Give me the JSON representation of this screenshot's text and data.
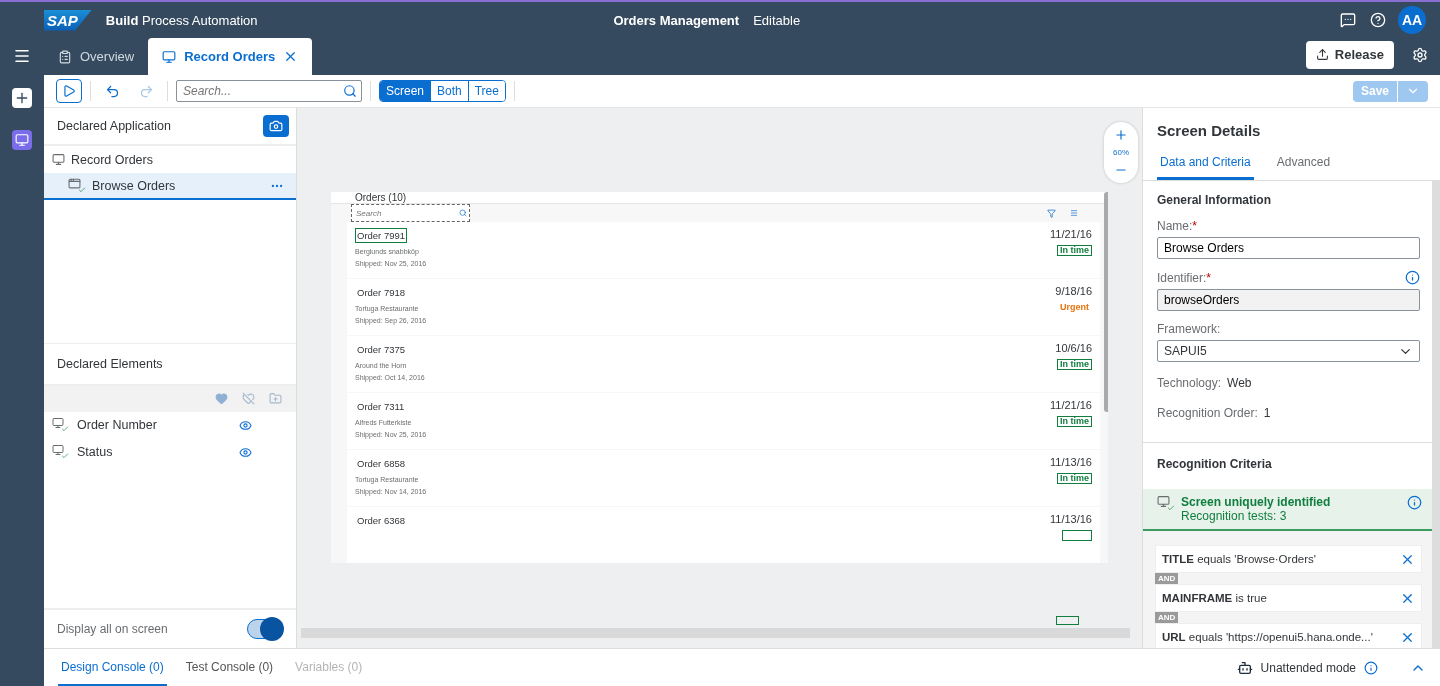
{
  "header": {
    "logo": "SAP",
    "product": "**Build** Process Automation",
    "title": "Orders Management",
    "mode": "Editable",
    "avatar": "AA"
  },
  "doc_tabs": [
    {
      "label": "Overview",
      "kind": "overview",
      "selected": false,
      "closable": false
    },
    {
      "label": "Record Orders",
      "kind": "recording",
      "selected": true,
      "closable": true
    }
  ],
  "release_button": "Release",
  "toolbar": {
    "search_placeholder": "Search...",
    "undo_disabled": false,
    "redo_disabled": true,
    "views": [
      {
        "label": "Screen",
        "selected": true
      },
      {
        "label": "Both",
        "selected": false
      },
      {
        "label": "Tree",
        "selected": false
      }
    ],
    "save": {
      "label": "Save",
      "disabled": true
    }
  },
  "declared_application": {
    "title": "Declared Application",
    "tree": [
      {
        "label": "Record Orders",
        "kind": "application",
        "selected": false,
        "children": [
          {
            "label": "Browse Orders",
            "kind": "screen",
            "selected": true
          }
        ]
      }
    ]
  },
  "declared_elements": {
    "title": "Declared Elements",
    "items": [
      {
        "label": "Order Number",
        "visible": true
      },
      {
        "label": "Status",
        "visible": true
      }
    ]
  },
  "display_all": {
    "label": "Display all on screen",
    "on": true
  },
  "preview": {
    "zoom": "60%",
    "title": "Orders (10)",
    "search_placeholder": "Search",
    "orders": [
      {
        "number": "Order 7991",
        "customer": "Berglunds snabbköp",
        "shipped": "Shipped: Nov 25, 2016",
        "date": "11/21/16",
        "status": "In time",
        "color": "#107e3e",
        "framed": true,
        "highlighted": true
      },
      {
        "number": "Order 7918",
        "customer": "Tortuga Restaurante",
        "shipped": "Shipped: Sep 26, 2016",
        "date": "9/18/16",
        "status": "Urgent",
        "color": "#e9730c",
        "framed": false,
        "highlighted": false
      },
      {
        "number": "Order 7375",
        "customer": "Around the Horn",
        "shipped": "Shipped: Oct 14, 2016",
        "date": "10/6/16",
        "status": "In time",
        "color": "#107e3e",
        "framed": true,
        "highlighted": false
      },
      {
        "number": "Order 7311",
        "customer": "Alfreds Futterkiste",
        "shipped": "Shipped: Nov 25, 2016",
        "date": "11/21/16",
        "status": "In time",
        "color": "#107e3e",
        "framed": true,
        "highlighted": false
      },
      {
        "number": "Order 6858",
        "customer": "Tortuga Restaurante",
        "shipped": "Shipped: Nov 14, 2016",
        "date": "11/13/16",
        "status": "In time",
        "color": "#107e3e",
        "framed": true,
        "highlighted": false
      },
      {
        "number": "Order 6368",
        "date": "11/13/16",
        "color": "#107e3e",
        "framed": true,
        "highlighted": false
      }
    ]
  },
  "screen_details": {
    "title": "Screen Details",
    "tabs": [
      {
        "label": "Data and Criteria",
        "selected": true
      },
      {
        "label": "Advanced",
        "selected": false
      }
    ],
    "general": {
      "title": "General Information",
      "name_label": "Name:",
      "name_mark": "*",
      "name": "Browse Orders",
      "identifier_label": "Identifier:",
      "identifier_mark": "*",
      "identifier": "browseOrders",
      "framework_label": "Framework:",
      "framework": "SAPUI5",
      "technology_label": "Technology:",
      "technology": "Web",
      "order_label": "Recognition Order:",
      "order": "1"
    },
    "criteria": {
      "title": "Recognition Criteria",
      "status": "Screen uniquely identified",
      "tests": "Recognition tests: 3",
      "rules": [
        {
          "text": "**TITLE** equals 'Browse·Orders'"
        },
        {
          "connector": "AND",
          "text": "**MAINFRAME** is true"
        },
        {
          "connector": "AND",
          "text": "**URL** equals 'https://openui5.hana.onde...'"
        }
      ]
    }
  },
  "console_tabs": [
    {
      "label": "Design Console (0)",
      "selected": true,
      "disabled": false
    },
    {
      "label": "Test Console (0)",
      "selected": false,
      "disabled": false
    },
    {
      "label": "Variables (0)",
      "selected": false,
      "disabled": true
    }
  ],
  "unattended": "Unattended mode"
}
